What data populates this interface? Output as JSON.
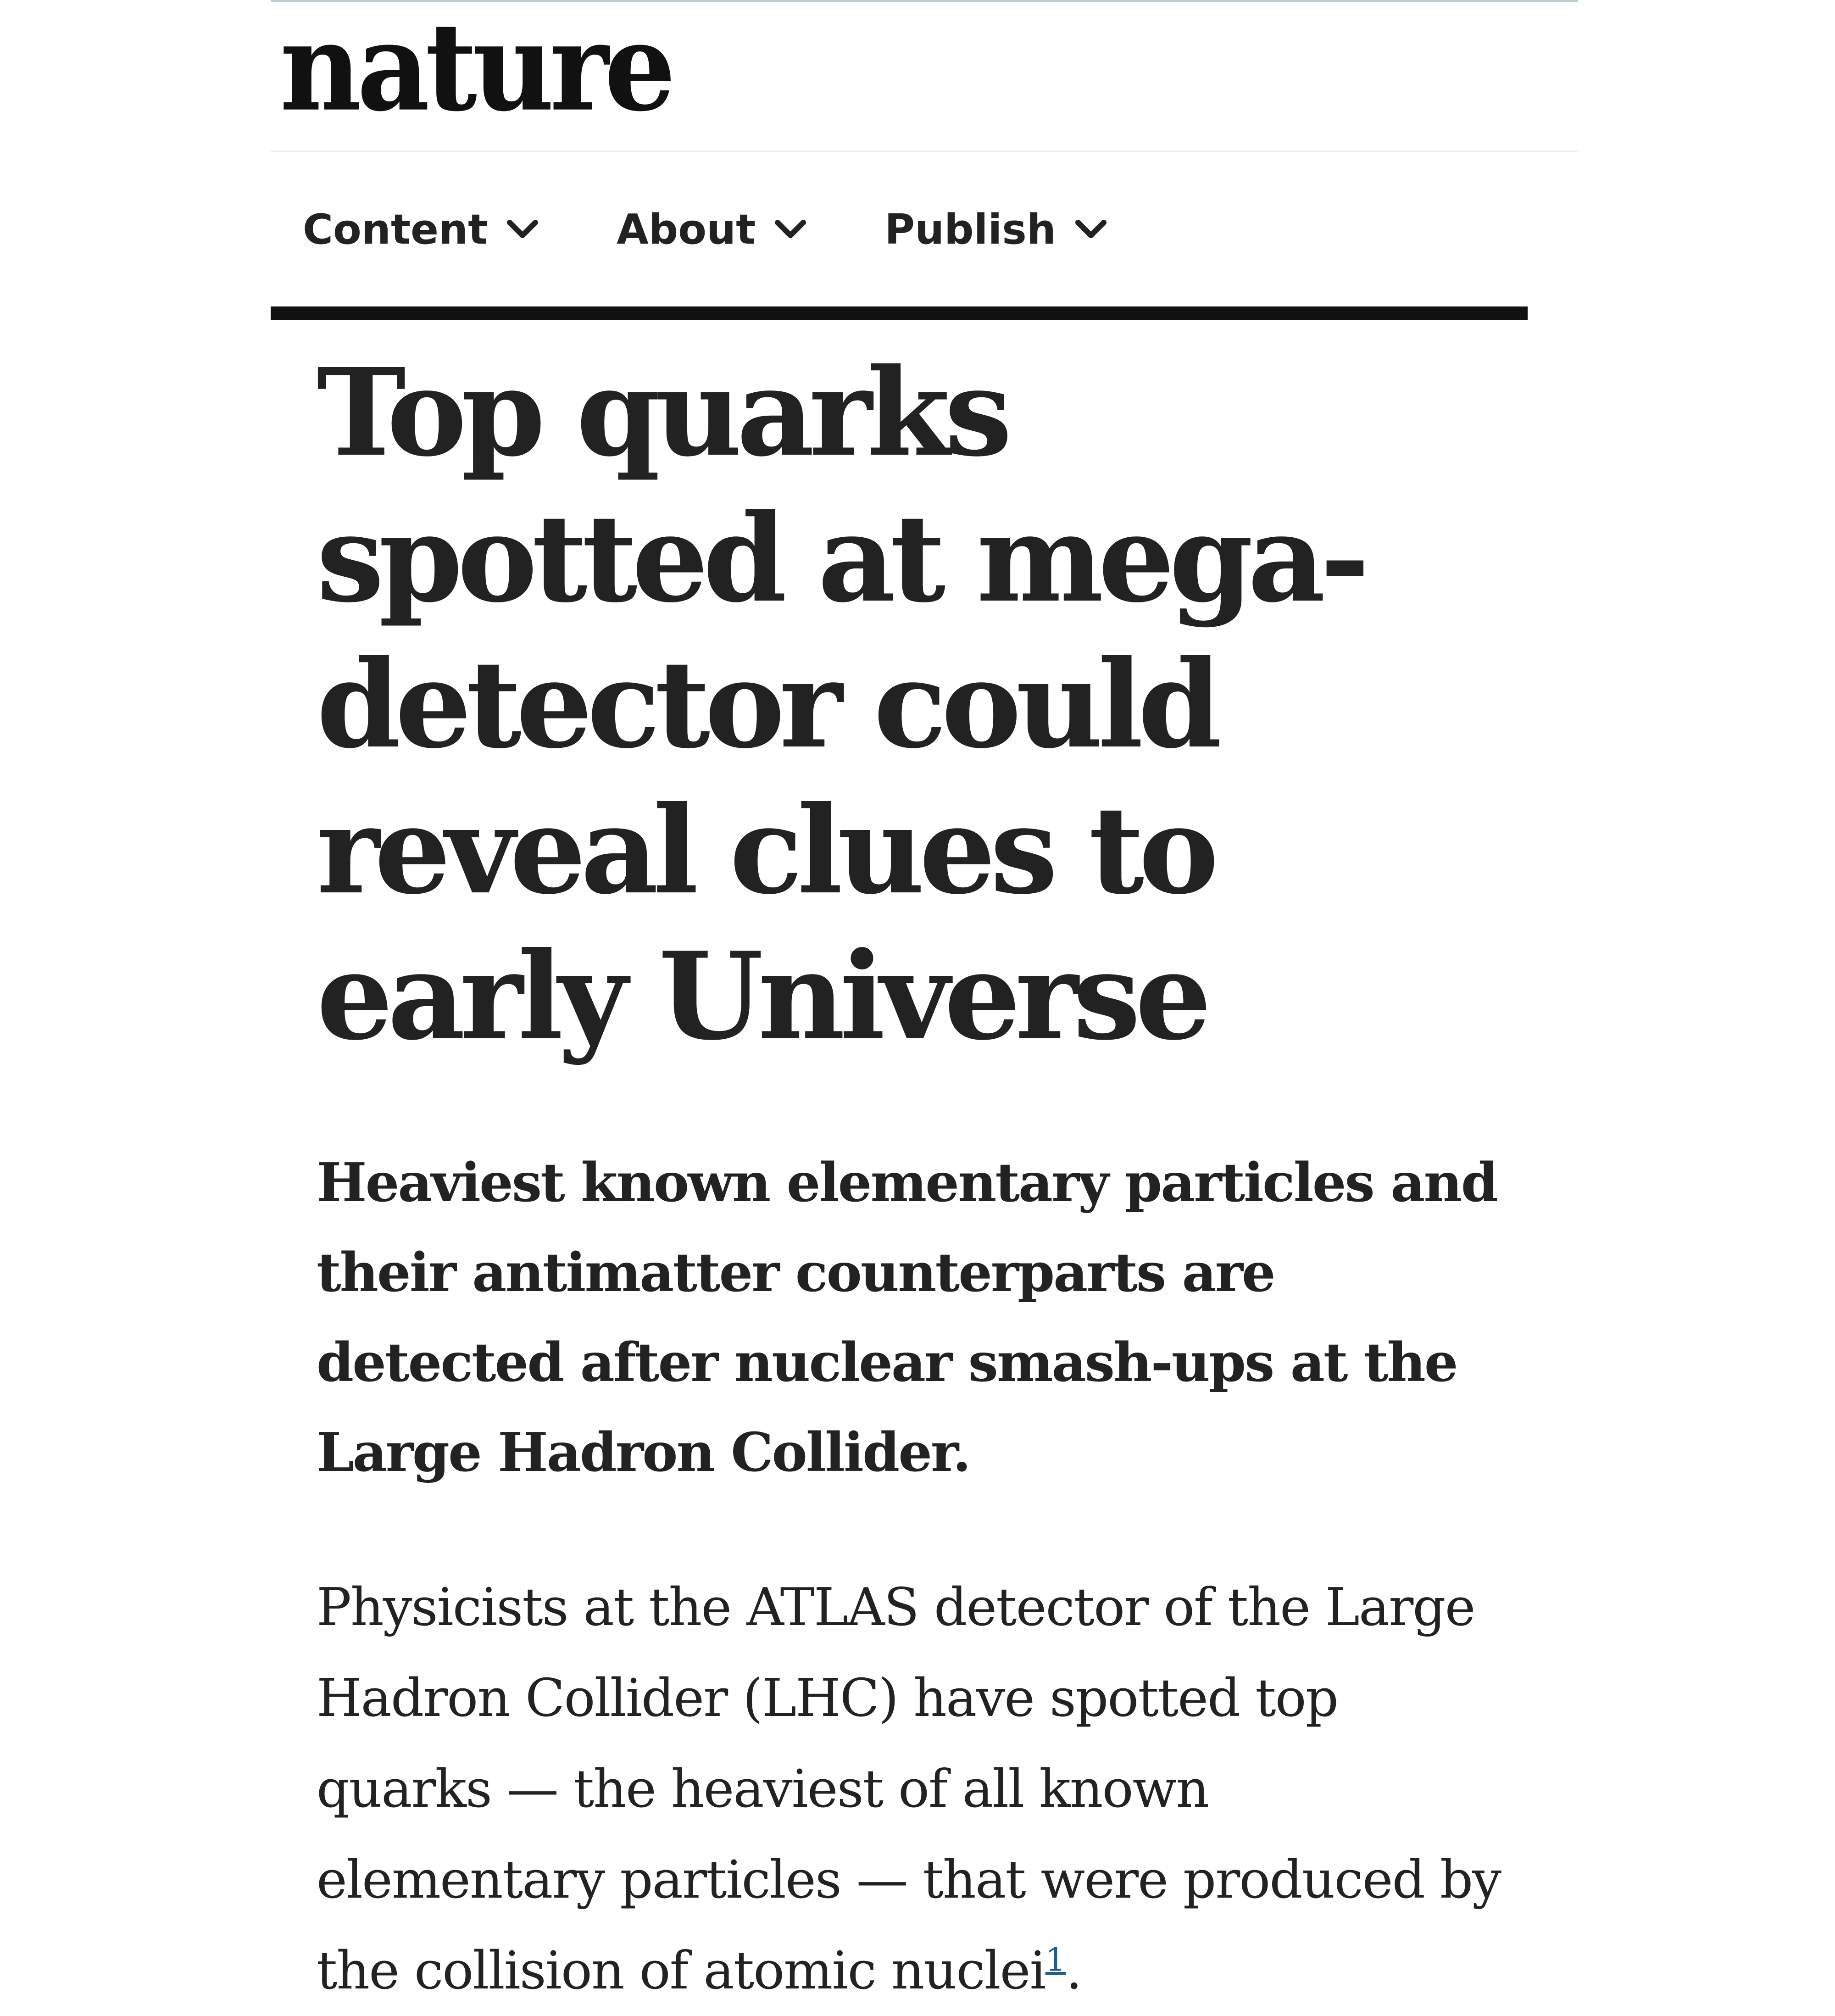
{
  "site": {
    "logo": "nature"
  },
  "nav": {
    "items": [
      {
        "label": "Content",
        "icon": "chevron-down-icon"
      },
      {
        "label": "About",
        "icon": "chevron-down-icon"
      },
      {
        "label": "Publish",
        "icon": "chevron-down-icon"
      }
    ]
  },
  "article": {
    "headline": "Top quarks spotted at mega-detector could reveal clues to early Universe",
    "standfirst": "Heaviest known elementary particles and their antimatter counterparts are detected after nuclear smash-ups at the Large Hadron Collider.",
    "body": {
      "text_before_ref": "Physicists at the ATLAS detector of the Large Hadron Collider (LHC) have spotted top quarks — the heaviest of all known elementary particles — that were produced by the collision of atomic nuclei",
      "reference": "1",
      "text_after_ref": "."
    }
  },
  "colors": {
    "text": "#222222",
    "link": "#1a5d8f",
    "rule": "#111111",
    "top_accent": "#b9cfd2"
  }
}
